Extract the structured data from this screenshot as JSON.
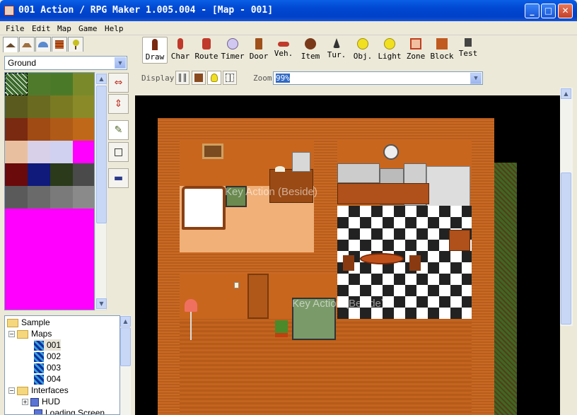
{
  "window": {
    "title": "001 Action / RPG Maker 1.005.004 - [Map - 001]",
    "min": "_",
    "max": "□",
    "close": "✕"
  },
  "menu": [
    "File",
    "Edit",
    "Map",
    "Game",
    "Help"
  ],
  "left": {
    "tile_layer": "Ground",
    "tree": {
      "root": "Sample",
      "maps_label": "Maps",
      "maps": [
        "001",
        "002",
        "003",
        "004"
      ],
      "interfaces_label": "Interfaces",
      "hud": "HUD",
      "loading": "Loading Screen"
    }
  },
  "toolbar": {
    "tools": [
      "Draw",
      "Char",
      "Route",
      "Timer",
      "Door",
      "Veh.",
      "Item",
      "Tur.",
      "Obj.",
      "Light",
      "Zone",
      "Block",
      "Test"
    ],
    "display_label": "Display",
    "zoom_label": "Zoom",
    "zoom_value": "99%"
  },
  "map": {
    "action_label_1": "Key Action (Beside)",
    "action_label_2": "Key Action (Beside)"
  },
  "colors": {
    "accent": "#0a5fe6",
    "tile_magenta": "#ff00ff",
    "brick": "#c96a24"
  }
}
